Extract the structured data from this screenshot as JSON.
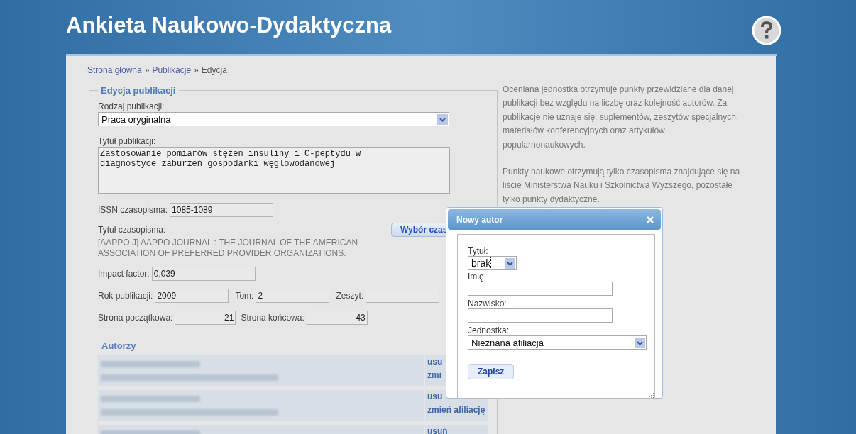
{
  "header": {
    "title": "Ankieta Naukowo-Dydaktyczna"
  },
  "breadcrumb": [
    {
      "label": "Strona główna",
      "link": true,
      "separator": "»"
    },
    {
      "label": "Publikacje",
      "link": true,
      "separator": "»"
    },
    {
      "label": "Edycja",
      "link": false
    }
  ],
  "form": {
    "legend": "Edycja publikacji",
    "type": {
      "label": "Rodzaj publikacji:",
      "value": "Praca oryginalna"
    },
    "title": {
      "label": "Tytuł publikacji:",
      "value": "Zastosowanie pomiarów stężeń insuliny i C-peptydu w\ndiagnostyce zaburzeń gospodarki węglowodanowej"
    },
    "issn": {
      "label": "ISSN czasopisma:",
      "value": "1085-1089"
    },
    "journal": {
      "label": "Tytuł czasopisma:",
      "value": "[AAPPO J] AAPPO JOURNAL : THE JOURNAL OF THE AMERICAN ASSOCIATION OF PREFERRED PROVIDER ORGANIZATIONS.",
      "button": "Wybór czas"
    },
    "impact": {
      "label": "Impact factor:",
      "value": "0,039"
    },
    "year": {
      "label": "Rok publikacji:",
      "value": "2009"
    },
    "volume": {
      "label": "Tom:",
      "value": "2"
    },
    "issue": {
      "label": "Zeszyt:"
    },
    "page_start": {
      "label": "Strona początkowa:",
      "value": "21"
    },
    "page_end": {
      "label": "Strona końcowa:",
      "value": "43"
    }
  },
  "authors": {
    "heading": "Autorzy",
    "items": [
      {
        "affiliation_shown": true,
        "actions": [
          "usu",
          "zmi"
        ]
      },
      {
        "affiliation_shown": true,
        "actions": [
          "usu",
          "zmień afiliację"
        ]
      },
      {
        "affiliation_shown": false,
        "actions": [
          "usuń"
        ]
      }
    ]
  },
  "info": [
    "Oceniana jednostka otrzymuje punkty przewidziane dla danej publikacji bez względu na liczbę oraz kolejność autorów. Za publikacje nie uznaje się: suplementów, zeszytów specjalnych, materiałów konferencyjnych oraz artykułów popularnonaukowych.",
    "Punkty naukowe otrzymują tylko czasopisma znajdujące się na liście Ministerstwa Nauku i Szkolnictwa Wyższego, pozostałe tylko punkty dydaktyczne."
  ],
  "dialog": {
    "title": "Nowy autor",
    "fields": [
      {
        "kind": "picker",
        "label": "Tytuł:",
        "value": "brak",
        "focused": true
      },
      {
        "kind": "input",
        "label": "Imię:"
      },
      {
        "kind": "input",
        "label": "Nazwisko:"
      },
      {
        "kind": "select",
        "label": "Jednostka:",
        "value": "Nieznana afiliacja",
        "focused": false
      }
    ],
    "button": "Zapisz"
  }
}
